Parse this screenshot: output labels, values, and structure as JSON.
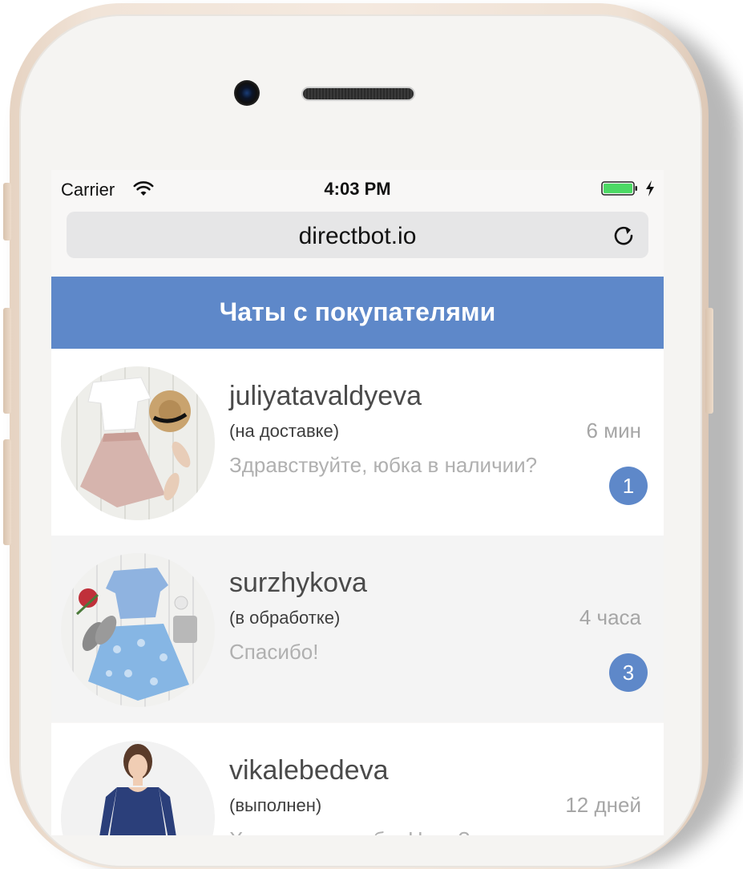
{
  "status_bar": {
    "carrier": "Carrier",
    "time": "4:03 PM",
    "wifi_icon": "wifi-icon",
    "battery_icon": "battery-icon",
    "charging_icon": "lightning-bolt-icon"
  },
  "browser": {
    "url": "directbot.io",
    "reload_icon": "reload-icon"
  },
  "header": {
    "title": "Чаты с покупателями"
  },
  "chats": [
    {
      "username": "juliyatavaldyeva",
      "status": "(на доставке)",
      "time": "6 мин",
      "message": "Здравствуйте, юбка в наличии?",
      "unread": "1"
    },
    {
      "username": "surzhykova",
      "status": "(в обработке)",
      "time": "4 часа",
      "message": "Спасибо!",
      "unread": "3"
    },
    {
      "username": "vikalebedeva",
      "status": "(выполнен)",
      "time": "12 дней",
      "message": "Хорошо, спасибо. Цена?"
    }
  ],
  "colors": {
    "accent": "#5e88c9",
    "row_white": "#ffffff",
    "row_gray": "#f4f4f4"
  }
}
